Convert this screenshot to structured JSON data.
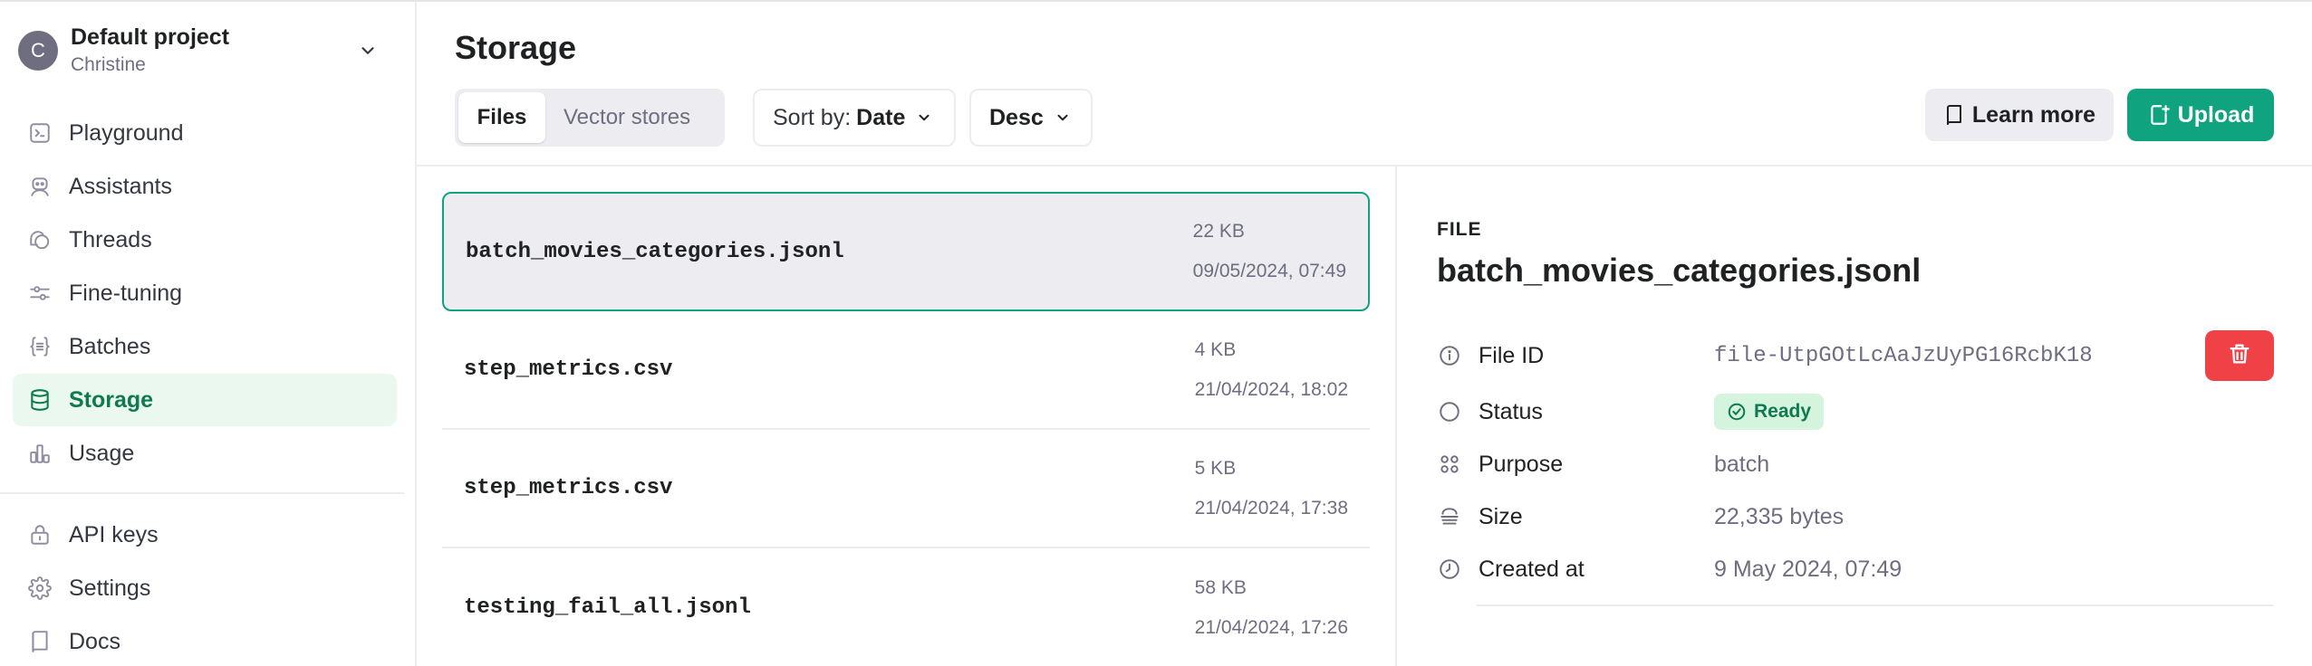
{
  "project": {
    "avatar_letter": "C",
    "name": "Default project",
    "user": "Christine"
  },
  "sidebar": {
    "items": [
      {
        "label": "Playground",
        "icon": "terminal-icon"
      },
      {
        "label": "Assistants",
        "icon": "robot-icon"
      },
      {
        "label": "Threads",
        "icon": "chat-bubbles-icon"
      },
      {
        "label": "Fine-tuning",
        "icon": "sliders-icon"
      },
      {
        "label": "Batches",
        "icon": "braces-list-icon"
      },
      {
        "label": "Storage",
        "icon": "database-icon",
        "active": true
      },
      {
        "label": "Usage",
        "icon": "bar-chart-icon"
      }
    ],
    "secondary": [
      {
        "label": "API keys",
        "icon": "lock-icon"
      },
      {
        "label": "Settings",
        "icon": "gear-icon"
      },
      {
        "label": "Docs",
        "icon": "book-icon"
      }
    ]
  },
  "page": {
    "title": "Storage",
    "tabs": [
      "Files",
      "Vector stores"
    ],
    "active_tab": "Files",
    "sort": {
      "prefix": "Sort by:",
      "value": "Date"
    },
    "order": "Desc",
    "learn_more": "Learn more",
    "upload": "Upload"
  },
  "files": [
    {
      "name": "batch_movies_categories.jsonl",
      "size": "22 KB",
      "date": "09/05/2024, 07:49",
      "selected": true
    },
    {
      "name": "step_metrics.csv",
      "size": "4 KB",
      "date": "21/04/2024, 18:02"
    },
    {
      "name": "step_metrics.csv",
      "size": "5 KB",
      "date": "21/04/2024, 17:38"
    },
    {
      "name": "testing_fail_all.jsonl",
      "size": "58 KB",
      "date": "21/04/2024, 17:26"
    }
  ],
  "detail": {
    "kicker": "FILE",
    "title": "batch_movies_categories.jsonl",
    "file_id_label": "File ID",
    "file_id": "file-UtpGOtLcAaJzUyPG16RcbK18",
    "status_label": "Status",
    "status": "Ready",
    "purpose_label": "Purpose",
    "purpose": "batch",
    "size_label": "Size",
    "size": "22,335 bytes",
    "created_label": "Created at",
    "created": "9 May 2024, 07:49"
  },
  "colors": {
    "accent": "#10a37f",
    "active_nav_bg": "#eaf8ef",
    "danger": "#ef4146",
    "ready_badge_bg": "#d4f4dd"
  }
}
